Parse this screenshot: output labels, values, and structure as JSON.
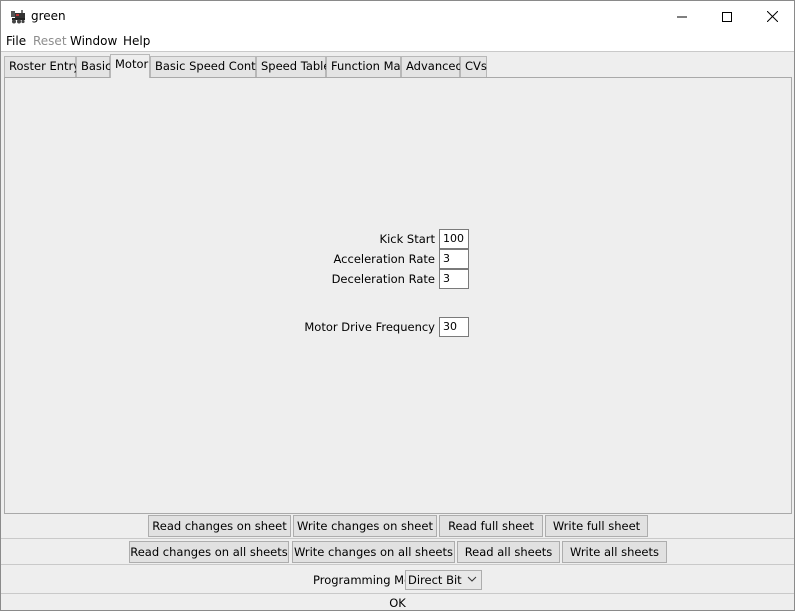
{
  "window": {
    "title": "green",
    "app_icon": "locomotive-icon"
  },
  "controls": {
    "minimize": "minimize-icon",
    "maximize": "maximize-icon",
    "close": "close-icon"
  },
  "menu": {
    "file": "File",
    "reset": "Reset",
    "window": "Window",
    "help": "Help"
  },
  "tabs": {
    "roster_entry": "Roster Entry",
    "basic": "Basic",
    "motor": "Motor",
    "basic_speed_control": "Basic Speed Control",
    "speed_table": "Speed Table",
    "function_map": "Function Map",
    "advanced": "Advanced",
    "cvs": "CVs",
    "active": "Motor"
  },
  "motor": {
    "kick_start_label": "Kick Start",
    "kick_start_value": "100",
    "acceleration_label": "Acceleration Rate",
    "acceleration_value": "3",
    "deceleration_label": "Deceleration Rate",
    "deceleration_value": "3",
    "drive_freq_label": "Motor Drive Frequency",
    "drive_freq_value": "30"
  },
  "buttons": {
    "read_changes_sheet": "Read changes on sheet",
    "write_changes_sheet": "Write changes on sheet",
    "read_full_sheet": "Read full sheet",
    "write_full_sheet": "Write full sheet",
    "read_changes_all": "Read changes on all sheets",
    "write_changes_all": "Write changes on all sheets",
    "read_all": "Read all sheets",
    "write_all": "Write all sheets"
  },
  "programming": {
    "label": "Programming Mode",
    "selected": "Direct Bit"
  },
  "status": {
    "text": "OK"
  }
}
